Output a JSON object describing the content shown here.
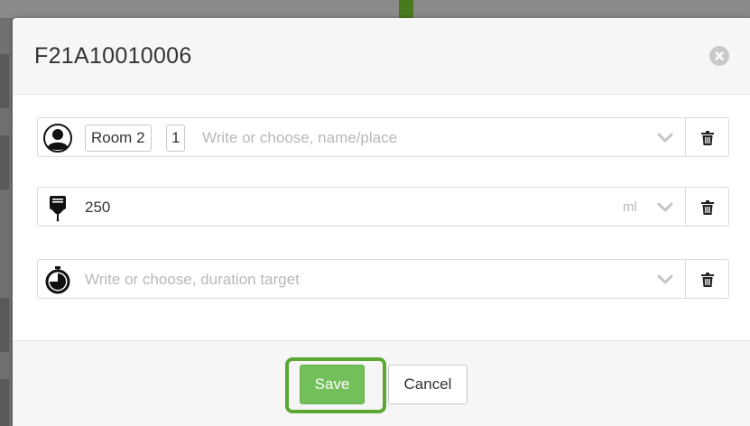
{
  "modal": {
    "title": "F21A10010006",
    "close_icon": "close-circle-icon"
  },
  "fields": {
    "location": {
      "icon": "user-avatar-icon",
      "chip_room": "Room 2",
      "chip_count": "1",
      "value": "",
      "placeholder": "Write or choose, name/place"
    },
    "volume": {
      "icon": "infusion-bag-icon",
      "value": "250",
      "unit": "ml"
    },
    "duration": {
      "icon": "stopwatch-icon",
      "value": "",
      "placeholder": "Write or choose, duration target"
    }
  },
  "footer": {
    "save_label": "Save",
    "cancel_label": "Cancel"
  },
  "colors": {
    "save_green": "#73c05a",
    "highlight_green": "#5aa832"
  }
}
